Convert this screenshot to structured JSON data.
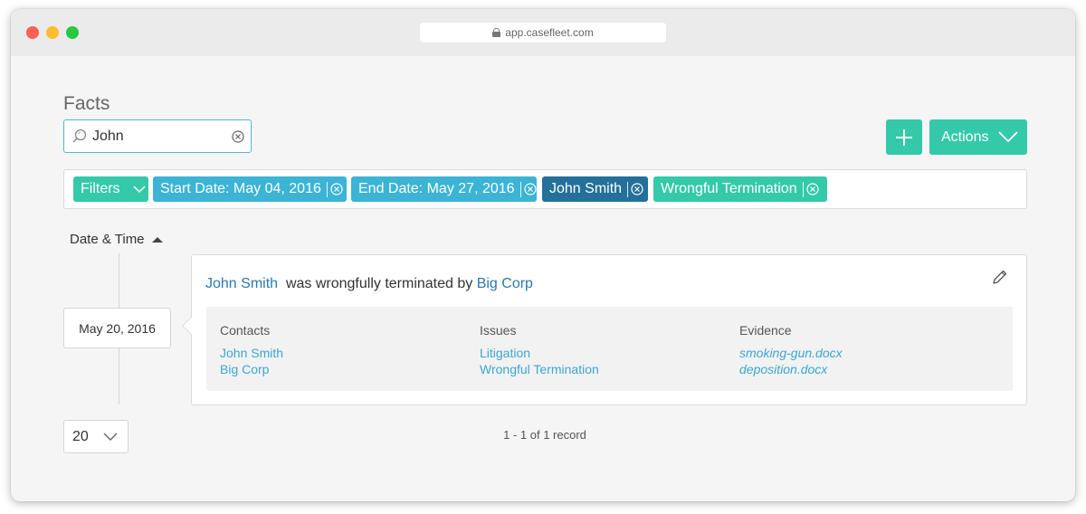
{
  "browser": {
    "url": "app.casefleet.com"
  },
  "page": {
    "title": "Facts"
  },
  "search": {
    "value": "John",
    "placeholder": ""
  },
  "toolbar": {
    "add_label": "+",
    "actions_label": "Actions"
  },
  "filters": {
    "toggle_label": "Filters",
    "chips": [
      {
        "label": "Start Date: May 04, 2016"
      },
      {
        "label": "End Date: May 27, 2016"
      },
      {
        "label": "John Smith"
      },
      {
        "label": "Wrongful Termination"
      }
    ]
  },
  "sort": {
    "label": "Date & Time",
    "direction": "ascending"
  },
  "facts": [
    {
      "date": "May 20, 2016",
      "subject": "John Smith",
      "verb": "was wrongfully terminated by",
      "object": "Big Corp",
      "contacts_header": "Contacts",
      "contacts": [
        "John Smith",
        "Big Corp"
      ],
      "issues_header": "Issues",
      "issues": [
        "Litigation",
        "Wrongful Termination"
      ],
      "evidence_header": "Evidence",
      "evidence": [
        "smoking-gun.docx",
        "deposition.docx"
      ]
    }
  ],
  "pagination": {
    "per_page": "20",
    "summary": "1 - 1 of 1 record"
  },
  "colors": {
    "teal": "#34c9a9",
    "blue": "#3bb4d6",
    "dark_blue": "#23709a",
    "link": "#2a7ab0"
  }
}
